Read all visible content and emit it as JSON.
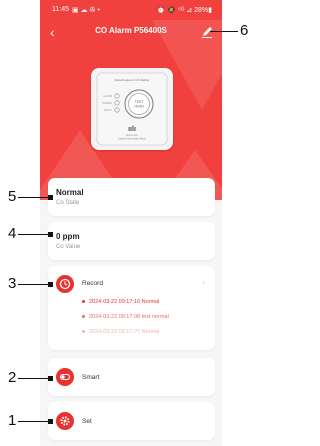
{
  "status_bar": {
    "time": "11:45",
    "left_icons": "▣ ☁ ✇ •",
    "right_icons": "⏰ 🔕 ⁵ᴳ ⊿ 28%▮"
  },
  "header": {
    "title": "CO Alarm P56400S"
  },
  "device_image": {
    "top_text": "Radiofrequenz CO-Melder",
    "button_text_1": "TEST",
    "button_text_2": "HUSH",
    "brand": "ıılı",
    "brand_sub_1": "Emos-CO",
    "brand_sub_2": "Carbon Monoxide Alarm",
    "indicator_labels": [
      "ALARM",
      "POWER",
      "FAULT"
    ]
  },
  "state_card": {
    "value": "Normal",
    "label": "Co State"
  },
  "value_card": {
    "value": "0 ppm",
    "label": "Co Value"
  },
  "record_card": {
    "label": "Record",
    "entries": [
      {
        "text": "2024-03-22 09:17:10 Normal",
        "color": "#e8322f"
      },
      {
        "text": "2024-03-22 09:17:08 test normal",
        "color": "#ee6a66"
      },
      {
        "text": "2024-03-22 09:17:?? Normal",
        "color": "#f6b0ae"
      }
    ]
  },
  "smart_card": {
    "label": "Smart"
  },
  "set_card": {
    "label": "Set"
  },
  "callouts": [
    "1",
    "2",
    "3",
    "4",
    "5",
    "6"
  ],
  "colors": {
    "accent": "#e8322f",
    "hero": "#f0413e",
    "background": "#f6f6f6"
  }
}
